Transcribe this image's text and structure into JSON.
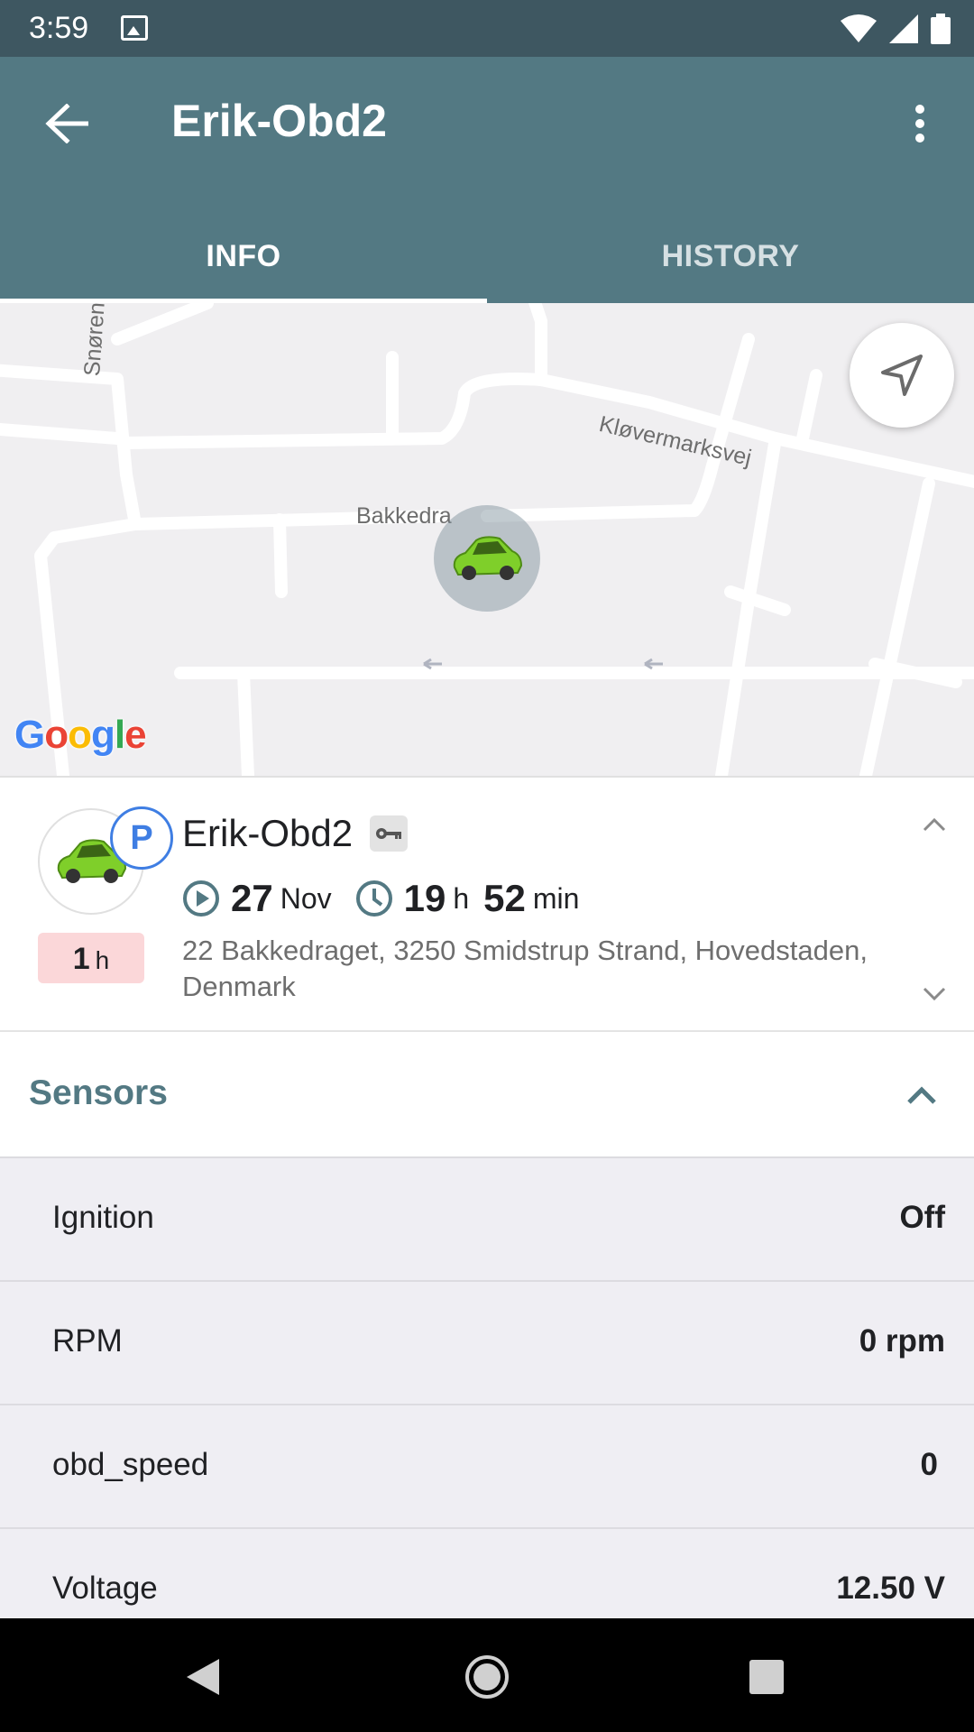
{
  "status_bar": {
    "time": "3:59"
  },
  "app_bar": {
    "title": "Erik-Obd2"
  },
  "tabs": [
    {
      "label": "INFO",
      "active": true
    },
    {
      "label": "HISTORY",
      "active": false
    }
  ],
  "map": {
    "street_labels": [
      "Snørengen",
      "Kløvermarksvej",
      "Bakkedraget"
    ],
    "provider": "Google",
    "marker_label": "Bakkedra"
  },
  "device": {
    "name": "Erik-Obd2",
    "status_badge": "P",
    "duration_value": "1",
    "duration_unit": "h",
    "date_day": "27",
    "date_month": "Nov",
    "time_hours": "19",
    "time_hours_unit": "h",
    "time_minutes": "52",
    "time_minutes_unit": "min",
    "address": "22 Bakkedraget, 3250 Smidstrup Strand, Hovedstaden, Denmark"
  },
  "sensors": {
    "title": "Sensors",
    "items": [
      {
        "name": "Ignition",
        "value": "Off"
      },
      {
        "name": "RPM",
        "value": "0 rpm"
      },
      {
        "name": "obd_speed",
        "value": "0"
      },
      {
        "name": "Voltage",
        "value": "12.50 V"
      }
    ]
  },
  "colors": {
    "status_bar": "#3e5761",
    "app_bar": "#537983",
    "parking_badge": "#3f7ee3",
    "duration_badge": "#fbd7d9",
    "sensor_row_bg": "#efeef3"
  }
}
